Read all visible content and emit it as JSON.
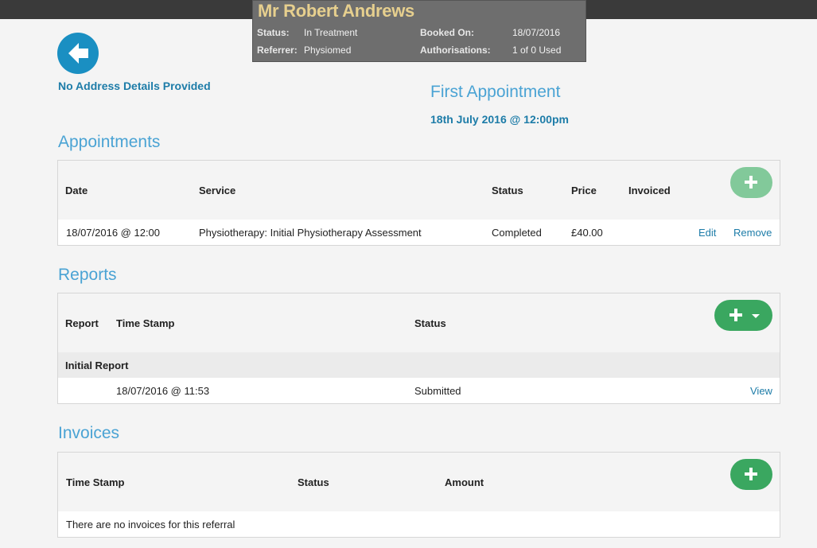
{
  "patient": {
    "name": "Mr Robert Andrews",
    "status_label": "Status:",
    "status_value": "In Treatment",
    "referrer_label": "Referrer:",
    "referrer_value": "Physiomed",
    "booked_label": "Booked On:",
    "booked_value": "18/07/2016",
    "auth_label": "Authorisations:",
    "auth_value": "1 of 0 Used"
  },
  "address_text": "No Address Details Provided",
  "first_appointment": {
    "title": "First Appointment",
    "datetime": "18th July 2016 @ 12:00pm"
  },
  "appointments": {
    "title": "Appointments",
    "columns": [
      "Date",
      "Service",
      "Status",
      "Price",
      "Invoiced"
    ],
    "rows": [
      {
        "date": "18/07/2016 @ 12:00",
        "service": "Physiotherapy: Initial Physiotherapy Assessment",
        "status": "Completed",
        "price": "£40.00",
        "invoiced": "",
        "edit_label": "Edit",
        "remove_label": "Remove"
      }
    ]
  },
  "reports": {
    "title": "Reports",
    "columns": [
      "Report",
      "Time Stamp",
      "Status"
    ],
    "groups": [
      {
        "name": "Initial Report",
        "rows": [
          {
            "timestamp": "18/07/2016 @ 11:53",
            "status": "Submitted",
            "view_label": "View"
          }
        ]
      }
    ]
  },
  "invoices": {
    "title": "Invoices",
    "columns": [
      "Time Stamp",
      "Status",
      "Amount"
    ],
    "empty_message": "There are no invoices for this referral"
  },
  "colors": {
    "accent_blue": "#1d7ca8",
    "heading_blue": "#4aa3d4",
    "add_green": "#3aa760",
    "name_gold": "#e6cf8e"
  },
  "icons": {
    "back": "arrow-left-circle-icon",
    "add": "plus-icon",
    "dropdown": "caret-down-icon"
  }
}
